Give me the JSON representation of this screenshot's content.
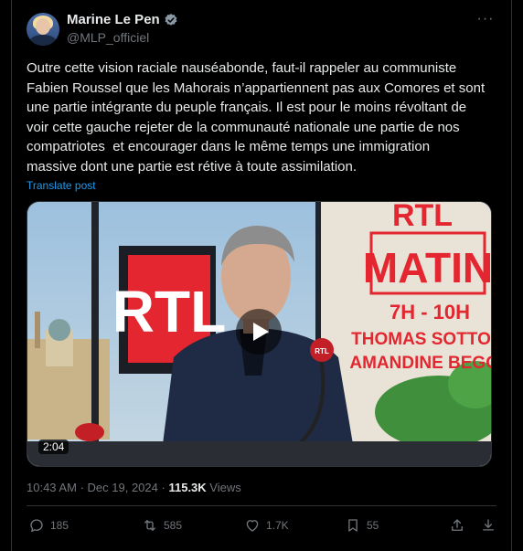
{
  "author": {
    "display_name": "Marine Le Pen",
    "handle": "@MLP_officiel",
    "verified_icon": "verified-badge-icon",
    "badge_color": "#8b98a5"
  },
  "post": {
    "text": "Outre cette vision raciale nauséabonde, faut-il rappeler au communiste\nFabien Roussel que les Mahorais n’appartiennent pas aux Comores et sont\nune partie intégrante du peuple français. Il est pour le moins révoltant de\nvoir cette gauche rejeter de la communauté nationale une partie de nos\ncompatriotes  et encourager dans le même temps une immigration\nmassive dont une partie est rétive à toute assimilation.",
    "translate_label": "Translate post"
  },
  "video": {
    "duration": "2:04",
    "overlay": {
      "logo": "RTL",
      "show": "MATIN",
      "hours": "7H - 10H",
      "host1": "THOMAS SOTTO &",
      "host2": "AMANDINE BEGOT",
      "mic_logo": "RTL"
    }
  },
  "meta": {
    "time": "10:43 AM",
    "separator": "·",
    "date": "Dec 19, 2024",
    "views_count": "115.3K",
    "views_label": "Views"
  },
  "actions": {
    "replies": "185",
    "reposts": "585",
    "likes": "1.7K",
    "bookmarks": "55"
  },
  "colors": {
    "background": "#000000",
    "text": "#e7e9ea",
    "muted": "#71767b",
    "link": "#1d9bf0",
    "rtl_red": "#e3262f"
  }
}
